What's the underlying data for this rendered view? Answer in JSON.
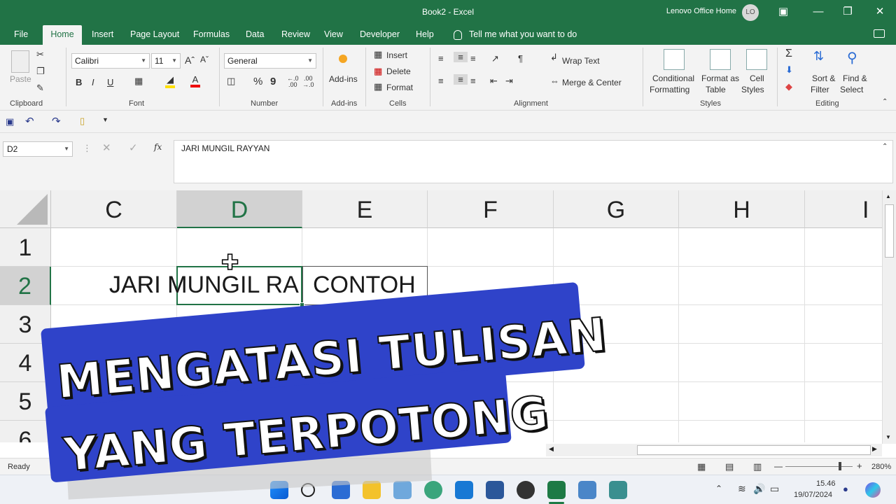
{
  "window": {
    "title": "Book2  -  Excel",
    "user_name": "Lenovo Office Home",
    "user_initials": "LO"
  },
  "menu": {
    "tabs": [
      "File",
      "Home",
      "Insert",
      "Page Layout",
      "Formulas",
      "Data",
      "Review",
      "View",
      "Developer",
      "Help"
    ],
    "active_tab": "Home",
    "tell_me": "Tell me what you want to do"
  },
  "ribbon": {
    "clipboard": {
      "paste": "Paste",
      "label": "Clipboard"
    },
    "font": {
      "name": "Calibri",
      "size": "11",
      "bold": "B",
      "italic": "I",
      "underline": "U",
      "label": "Font"
    },
    "number": {
      "format": "General",
      "percent": "%",
      "comma": "9",
      "label": "Number"
    },
    "addins": {
      "button": "Add-ins",
      "label": "Add-ins"
    },
    "cells": {
      "insert": "Insert",
      "delete": "Delete",
      "format": "Format",
      "label": "Cells"
    },
    "alignment": {
      "wrap": "Wrap Text",
      "merge": "Merge & Center",
      "label": "Alignment"
    },
    "styles": {
      "conditional_1": "Conditional",
      "conditional_2": "Formatting",
      "format_table_1": "Format as",
      "format_table_2": "Table",
      "cell_styles_1": "Cell",
      "cell_styles_2": "Styles",
      "label": "Styles"
    },
    "editing": {
      "sort_1": "Sort &",
      "sort_2": "Filter",
      "find_1": "Find &",
      "find_2": "Select",
      "label": "Editing"
    }
  },
  "formula_bar": {
    "name_box": "D2",
    "fx": "fx",
    "content": "JARI MUNGIL RAYYAN"
  },
  "grid": {
    "columns": [
      "C",
      "D",
      "E",
      "F",
      "G",
      "H",
      "I"
    ],
    "selected_column": "D",
    "rows": [
      "1",
      "2",
      "3",
      "4",
      "5",
      "6"
    ],
    "selected_row": "2",
    "cells": {
      "D2_visible": "JARI MUNGIL RA",
      "D2_prefix": "JARI M",
      "E2": "CONTOH"
    }
  },
  "overlay": {
    "line1": "MENGATASI  TULISAN",
    "line2": "YANG TERPOTONG"
  },
  "status_bar": {
    "ready": "Ready",
    "zoom": "280%"
  },
  "taskbar": {
    "time": "15.46",
    "date": "19/07/2024"
  },
  "colors": {
    "excel_green": "#217346",
    "banner_blue": "#2f43c9"
  }
}
